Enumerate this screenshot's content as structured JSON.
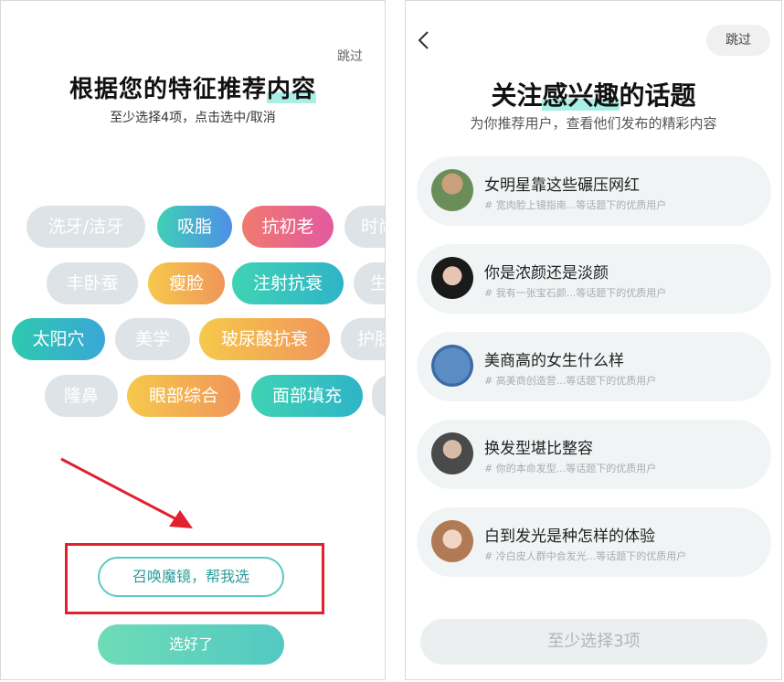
{
  "left": {
    "skip": "跳过",
    "title_main": "根据您的特征推荐",
    "title_highlight": "内容",
    "subtitle": "至少选择4项，点击选中/取消",
    "tags": [
      {
        "label": "洗牙/洁牙",
        "selected": false
      },
      {
        "label": "吸脂",
        "selected": true
      },
      {
        "label": "抗初老",
        "selected": true
      },
      {
        "label": "时尚",
        "selected": false
      },
      {
        "label": "丰卧蚕",
        "selected": false
      },
      {
        "label": "瘦脸",
        "selected": true
      },
      {
        "label": "注射抗衰",
        "selected": true
      },
      {
        "label": "生",
        "selected": false
      },
      {
        "label": "太阳穴",
        "selected": true
      },
      {
        "label": "美学",
        "selected": false
      },
      {
        "label": "玻尿酸抗衰",
        "selected": true
      },
      {
        "label": "护肤",
        "selected": false
      },
      {
        "label": "隆鼻",
        "selected": false
      },
      {
        "label": "眼部综合",
        "selected": true
      },
      {
        "label": "面部填充",
        "selected": true
      },
      {
        "label": "",
        "selected": false
      }
    ],
    "magic_button": "召唤魔镜，帮我选",
    "done_button": "选好了"
  },
  "right": {
    "skip": "跳过",
    "title_prefix": "关注",
    "title_highlight": "感兴趣",
    "title_suffix": "的话题",
    "subtitle": "为你推荐用户，查看他们发布的精彩内容",
    "topics": [
      {
        "title": "女明星靠这些碾压网红",
        "desc": "# 宽肉脸上镜指南...等话题下的优质用户"
      },
      {
        "title": "你是浓颜还是淡颜",
        "desc": "# 我有一张宝石颜...等话题下的优质用户"
      },
      {
        "title": "美商高的女生什么样",
        "desc": "# 高美商创造营...等话题下的优质用户"
      },
      {
        "title": "换发型堪比整容",
        "desc": "# 你的本命发型...等话题下的优质用户"
      },
      {
        "title": "白到发光是种怎样的体验",
        "desc": "# 冷白皮人群中会发光...等话题下的优质用户"
      }
    ],
    "min_button": "至少选择3项"
  },
  "colors": {
    "accent": "#52c9c3",
    "highlight": "#a8f0e6",
    "annotation_red": "#e0222e"
  }
}
